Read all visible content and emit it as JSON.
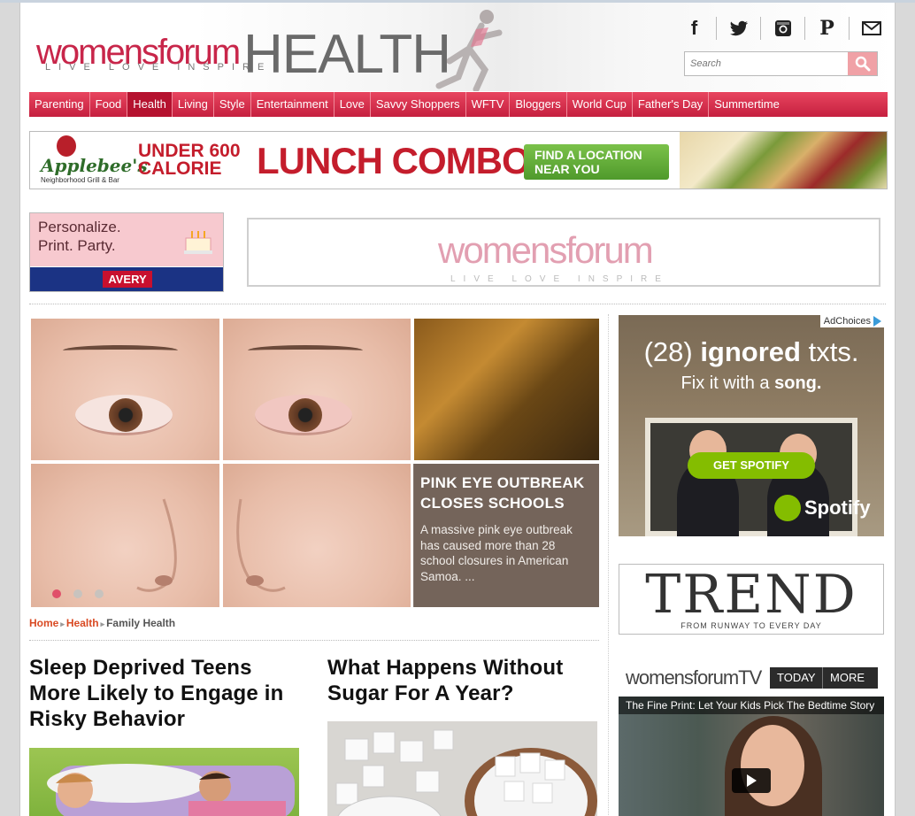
{
  "brand": {
    "logo_word": "womensforum",
    "logo_tag": "LIVE LOVE INSPIRE",
    "section_word": "HEALTH"
  },
  "social": [
    {
      "icon": "facebook-icon",
      "glyph": "f"
    },
    {
      "icon": "twitter-icon",
      "glyph": "🐦"
    },
    {
      "icon": "instagram-icon",
      "glyph": "◙"
    },
    {
      "icon": "pinterest-icon",
      "glyph": "𝒫"
    },
    {
      "icon": "mail-icon",
      "glyph": "✉"
    }
  ],
  "search": {
    "placeholder": "Search"
  },
  "nav": [
    "Parenting",
    "Food",
    "Health",
    "Living",
    "Style",
    "Entertainment",
    "Love",
    "Savvy Shoppers",
    "WFTV",
    "Bloggers",
    "World Cup",
    "Father's Day",
    "Summertime"
  ],
  "nav_active": "Health",
  "banner_ad": {
    "brand": "Applebee's",
    "brand_sub": "Neighborhood Grill & Bar",
    "headline_small": "UNDER 600 CALORIE",
    "headline_big": "LUNCH COMBOS",
    "cta": "FIND A LOCATION NEAR YOU"
  },
  "avery_ad": {
    "text": "Personalize. Print. Party.",
    "brand": "AVERY"
  },
  "feature": {
    "title": "PINK EYE OUTBREAK CLOSES SCHOOLS",
    "desc": "A massive pink eye outbreak has caused more than 28 school closures in American Samoa. ..."
  },
  "breadcrumb": {
    "home": "Home",
    "section": "Health",
    "current": "Family Health"
  },
  "articles": [
    {
      "title": "Sleep Deprived Teens More Likely to Engage in Risky Behavior"
    },
    {
      "title": "What Happens Without Sugar For A Year?"
    }
  ],
  "spotify_ad": {
    "adchoices": "AdChoices",
    "line1_pre": "(28) ",
    "line1_bold": "ignored",
    "line1_post": " txts.",
    "line2_pre": "Fix it with a ",
    "line2_bold": "song.",
    "cta": "GET SPOTIFY",
    "brand": "Spotify"
  },
  "trend_ad": {
    "title": "TREND",
    "tagline": "FROM RUNWAY TO EVERY DAY"
  },
  "tv": {
    "logo": "womensforumTV",
    "tabs": [
      "TODAY",
      "MORE"
    ],
    "video_title": "The Fine Print: Let Your Kids Pick The Bedtime Story"
  },
  "colors": {
    "accent": "#d52444",
    "nav_bg": "#d8324f",
    "link": "#d94a23",
    "spotify_green": "#84bd00"
  }
}
